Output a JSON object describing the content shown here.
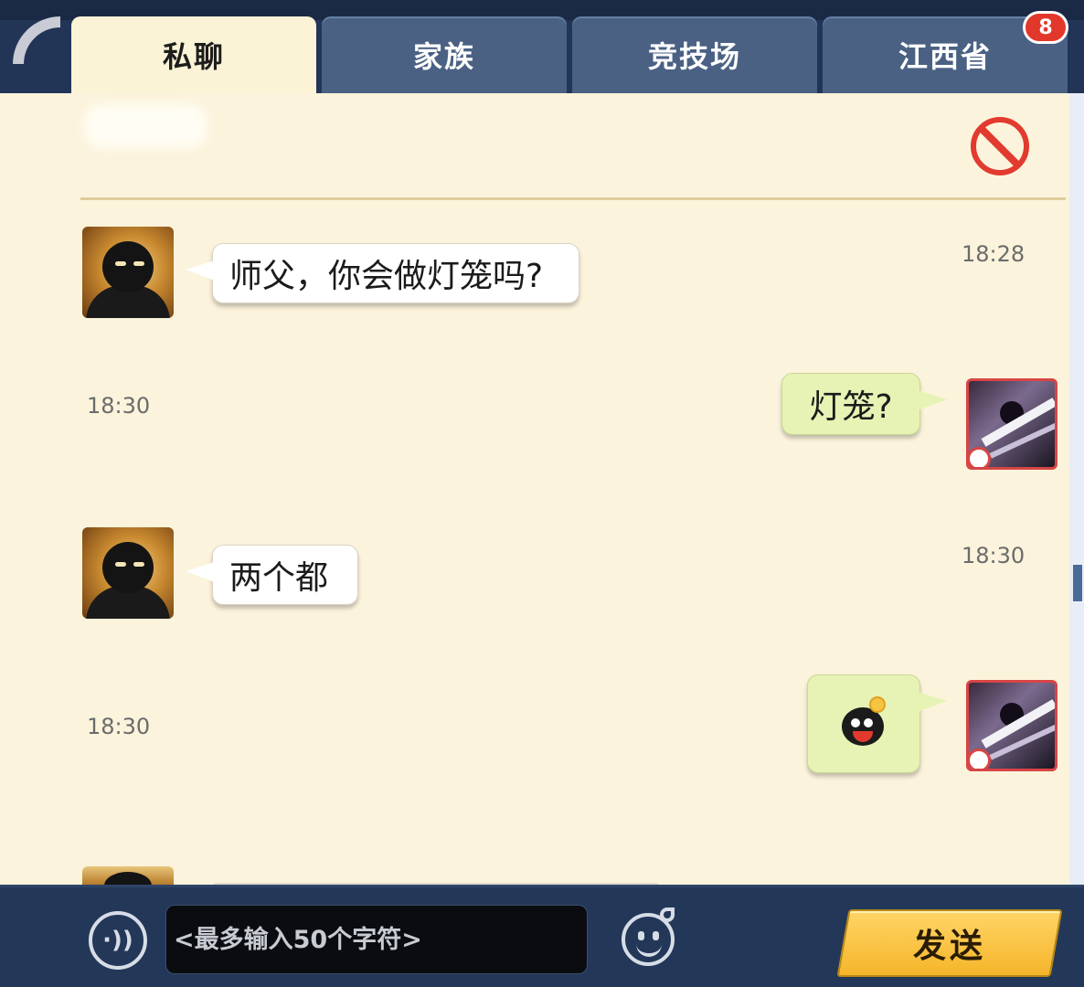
{
  "tabs": [
    {
      "label": "私聊",
      "active": true
    },
    {
      "label": "家族",
      "active": false
    },
    {
      "label": "竞技场",
      "active": false
    },
    {
      "label": "江西省",
      "active": false
    }
  ],
  "badge": {
    "count": "8"
  },
  "messages": [
    {
      "side": "left",
      "text": "师父，你会做灯笼吗?",
      "time": "18:28"
    },
    {
      "side": "right",
      "text": "灯笼?",
      "time": "18:30"
    },
    {
      "side": "left",
      "text": "两个都",
      "time": "18:30"
    },
    {
      "side": "right",
      "sticker": "lightbulb-face-sticker",
      "time": "18:30"
    }
  ],
  "input": {
    "placeholder": "<最多输入50个字符>",
    "value": ""
  },
  "send": {
    "label": "发送"
  },
  "colors": {
    "panel": "#fcf3dc",
    "tab_inactive": "#4a6184",
    "bubble_right": "#e6f3b4",
    "send_button": "#f5b52a",
    "block_icon": "#e23a2f"
  },
  "icons": {
    "back": "arc-back-icon",
    "block": "block-icon",
    "voice": "voice-icon",
    "emoji": "emoji-icon"
  }
}
